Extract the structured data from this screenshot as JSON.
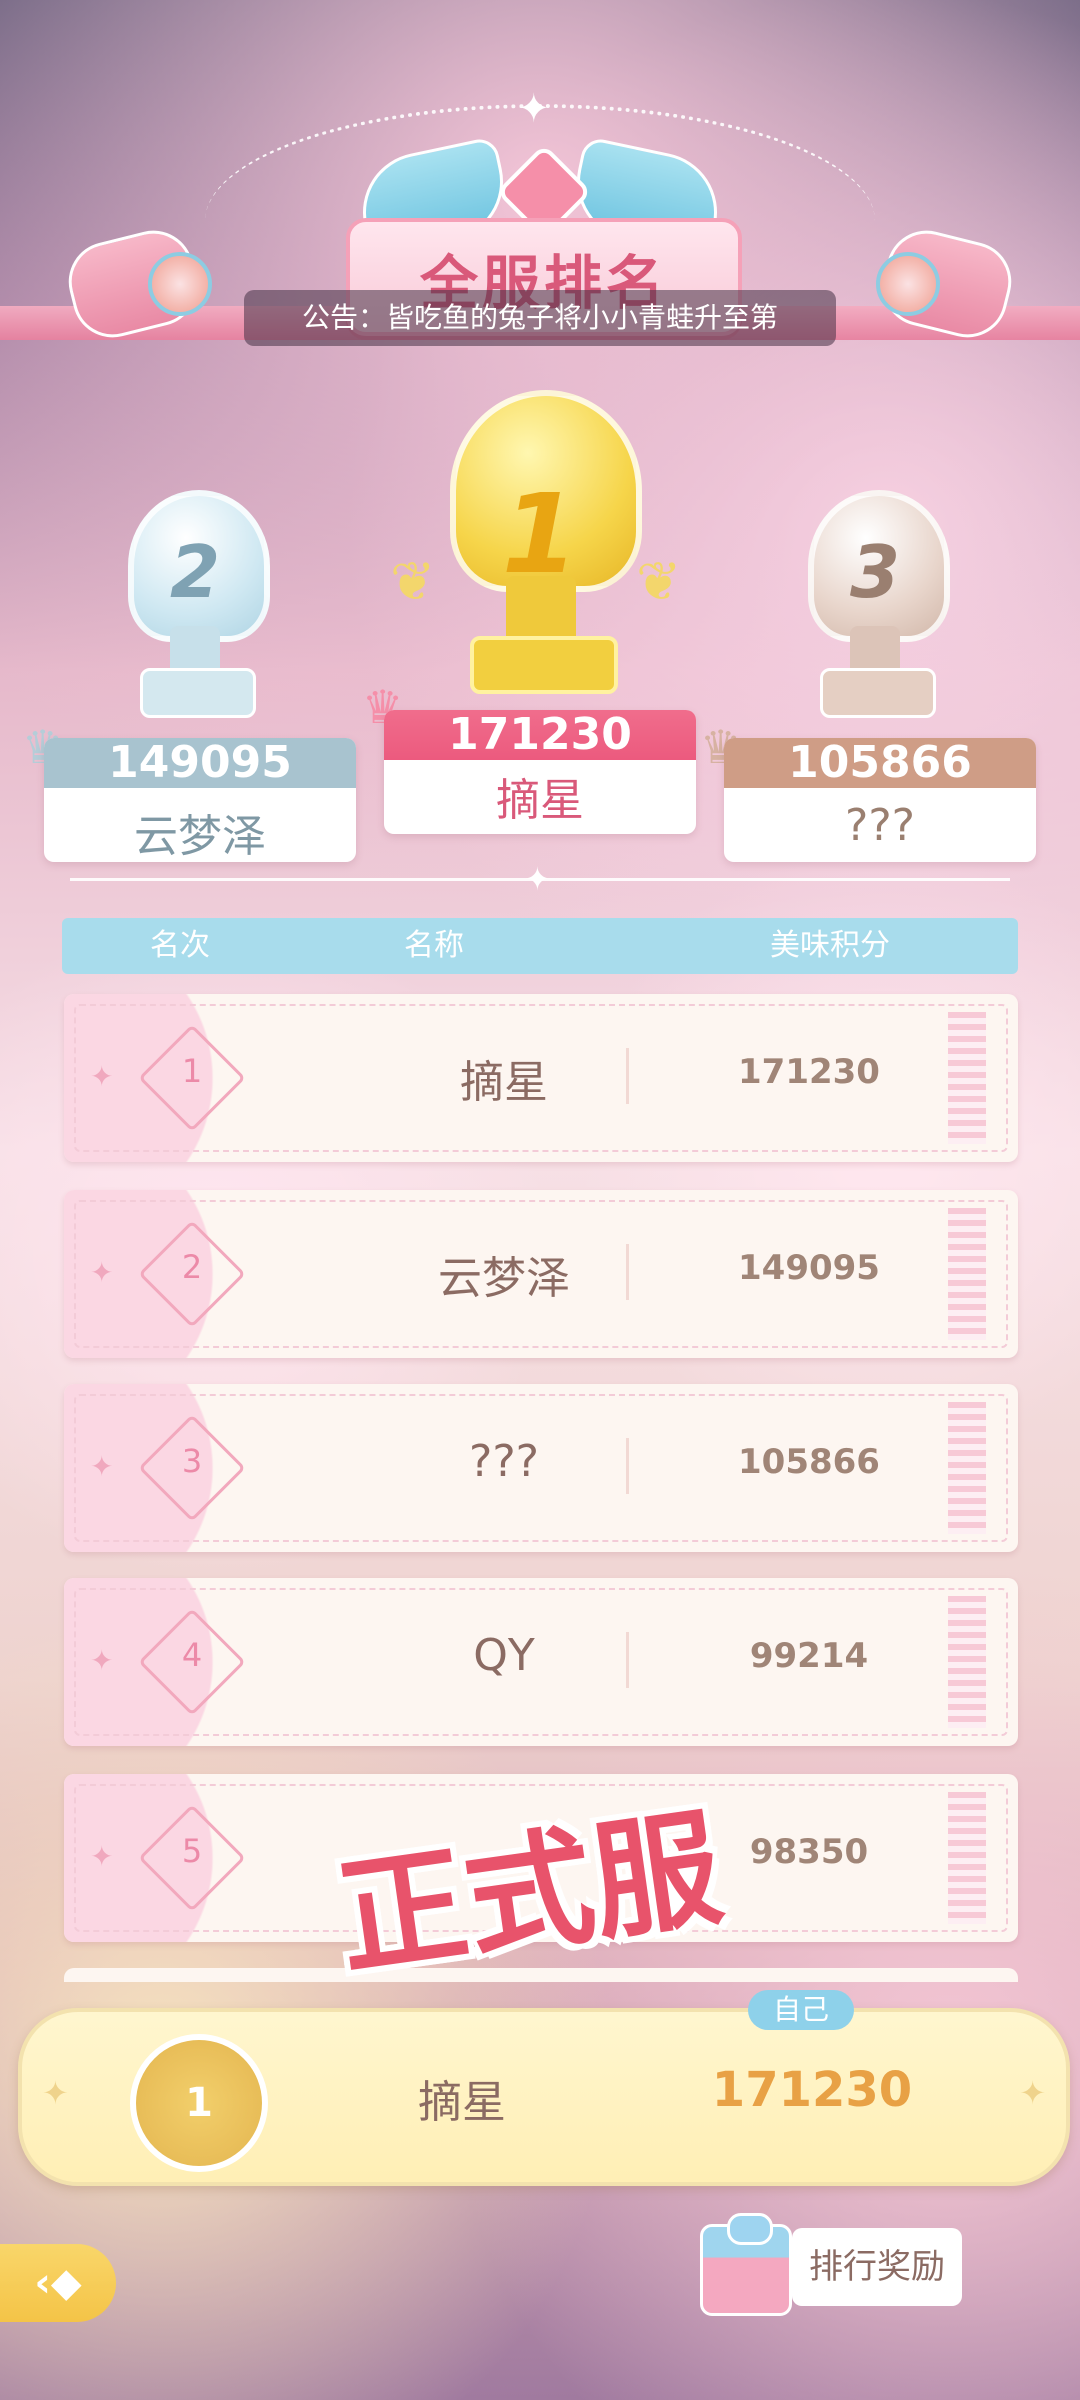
{
  "title": "全服排名",
  "notice": "公告：皆吃鱼的兔子将小小青蛙升至第",
  "top3": [
    {
      "rank": 1,
      "score": "171230",
      "name": "摘星"
    },
    {
      "rank": 2,
      "score": "149095",
      "name": "云梦泽"
    },
    {
      "rank": 3,
      "score": "105866",
      "name": "???"
    }
  ],
  "table_headers": {
    "rank": "名次",
    "name": "名称",
    "score": "美味积分"
  },
  "rows": [
    {
      "rank": "1",
      "name": "摘星",
      "score": "171230"
    },
    {
      "rank": "2",
      "name": "云梦泽",
      "score": "149095"
    },
    {
      "rank": "3",
      "name": "???",
      "score": "105866"
    },
    {
      "rank": "4",
      "name": "QY",
      "score": "99214"
    },
    {
      "rank": "5",
      "name": "",
      "score": "98350"
    }
  ],
  "watermark": "正式服",
  "self": {
    "tag": "自己",
    "rank": "1",
    "name": "摘星",
    "score": "171230"
  },
  "reward_button": "排行奖励",
  "colors": {
    "accent_pink": "#ec5a7e",
    "header_blue": "#a8dcec",
    "gold": "#e8a145"
  },
  "icons": [
    "star-icon",
    "crown-icon",
    "trophy-icon",
    "laurel-icon",
    "diamond-icon",
    "gift-icon",
    "back-arrow-icon"
  ]
}
